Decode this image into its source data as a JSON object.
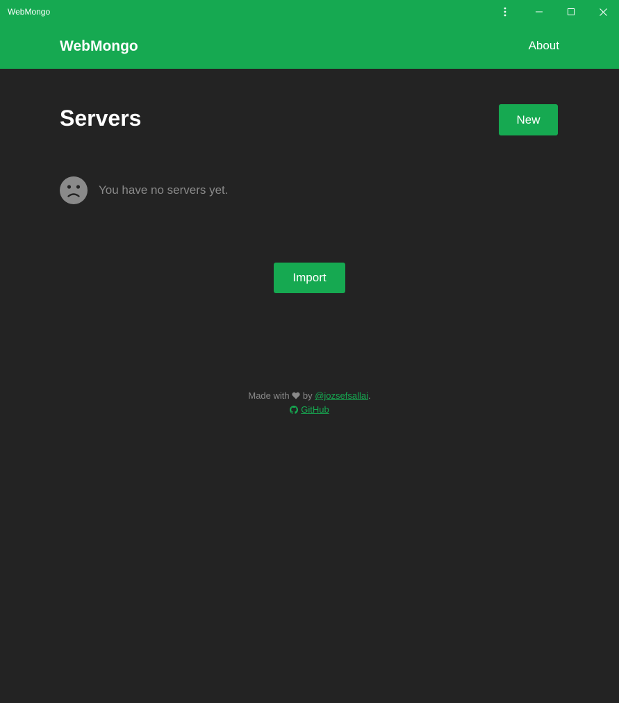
{
  "window": {
    "title": "WebMongo",
    "menu_icon": "more-vertical-icon",
    "minimize_icon": "minimize-icon",
    "maximize_icon": "maximize-icon",
    "close_icon": "close-icon"
  },
  "navbar": {
    "brand": "WebMongo",
    "about_label": "About"
  },
  "main": {
    "title": "Servers",
    "new_button_label": "New",
    "empty_icon": "sad-face-icon",
    "empty_message": "You have no servers yet.",
    "import_button_label": "Import"
  },
  "footer": {
    "made_with_prefix": "Made with",
    "heart_icon": "heart-icon",
    "by_text": "by",
    "author_link": "@jozsefsallai",
    "period": ".",
    "github_icon": "github-icon",
    "github_label": "GitHub"
  },
  "colors": {
    "accent": "#16a951",
    "background": "#232323",
    "muted_text": "#8a8a8a"
  }
}
